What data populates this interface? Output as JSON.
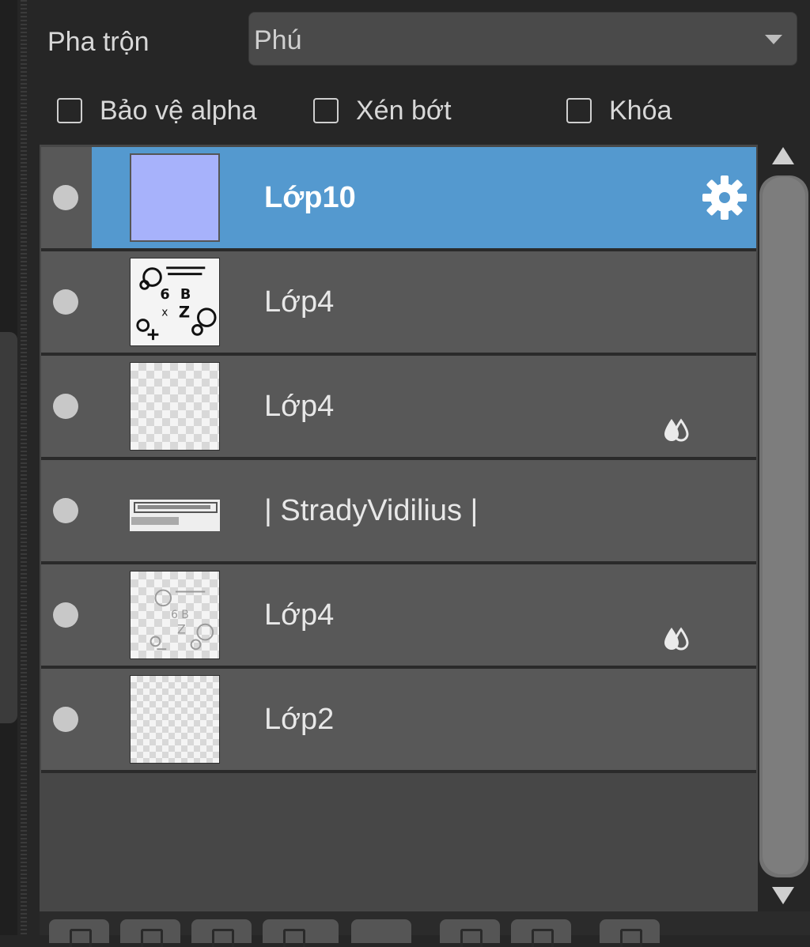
{
  "blend": {
    "label": "Pha trộn",
    "value": "Phú"
  },
  "checkboxes": [
    {
      "label": "Bảo vệ alpha",
      "checked": false
    },
    {
      "label": "Xén bớt",
      "checked": false
    },
    {
      "label": "Khóa",
      "checked": false
    }
  ],
  "layers": [
    {
      "name": "Lớp10",
      "selected": true,
      "visible": true,
      "thumb": "solid-blue",
      "has_settings_icon": true
    },
    {
      "name": "Lớp4",
      "selected": false,
      "visible": true,
      "thumb": "sketch"
    },
    {
      "name": "Lớp4",
      "selected": false,
      "visible": true,
      "thumb": "transparent",
      "has_alpha_icon": true
    },
    {
      "name": "| StradyVidilius |",
      "selected": false,
      "visible": true,
      "thumb": "text-strip"
    },
    {
      "name": "Lớp4",
      "selected": false,
      "visible": true,
      "thumb": "sketch-light",
      "has_alpha_icon": true
    },
    {
      "name": "Lớp2",
      "selected": false,
      "visible": true,
      "thumb": "checker"
    }
  ],
  "colors": {
    "selection": "#5499cf",
    "row": "#585858",
    "panel": "#262626",
    "layer10_color": "#a7b2fb"
  },
  "icons": [
    "gear-icon",
    "alpha-lock-icon",
    "visibility-dot-icon",
    "scroll-up-icon",
    "scroll-down-icon",
    "dropdown-arrow-icon"
  ]
}
